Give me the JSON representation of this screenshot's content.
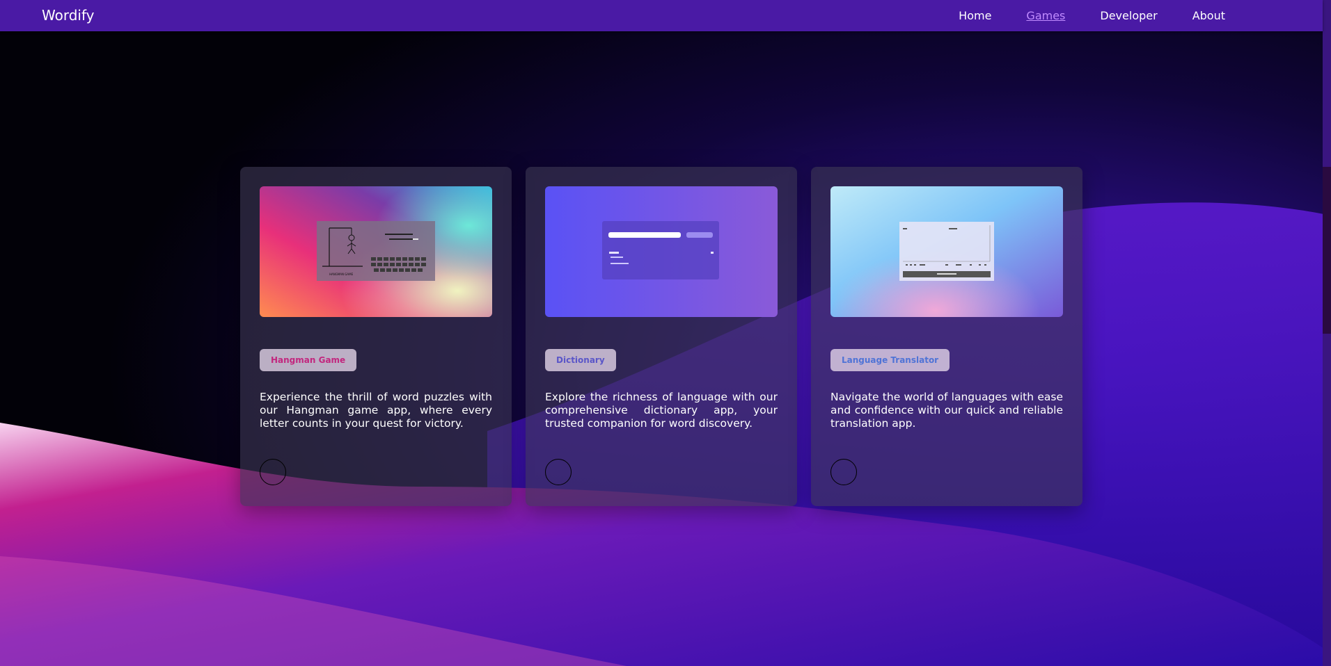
{
  "brand": "Wordify",
  "nav": [
    "Home",
    "Games",
    "Developer",
    "About"
  ],
  "active_nav": "Games",
  "cards": [
    {
      "tag": "Hangman Game",
      "tag_color": "#c2267e",
      "description": "Experience the thrill of word puzzles with our Hangman game app, where every letter counts in your quest for victory.",
      "preview_title": "HANGMAN GAME"
    },
    {
      "tag": "Dictionary",
      "tag_color": "#5a56c8",
      "description": "Explore the richness of language with our comprehensive dictionary app, your trusted companion for word discovery."
    },
    {
      "tag": "Language Translator",
      "tag_color": "#4f73d6",
      "description": "Navigate the world of languages with ease and confidence with our quick and reliable translation app."
    }
  ]
}
